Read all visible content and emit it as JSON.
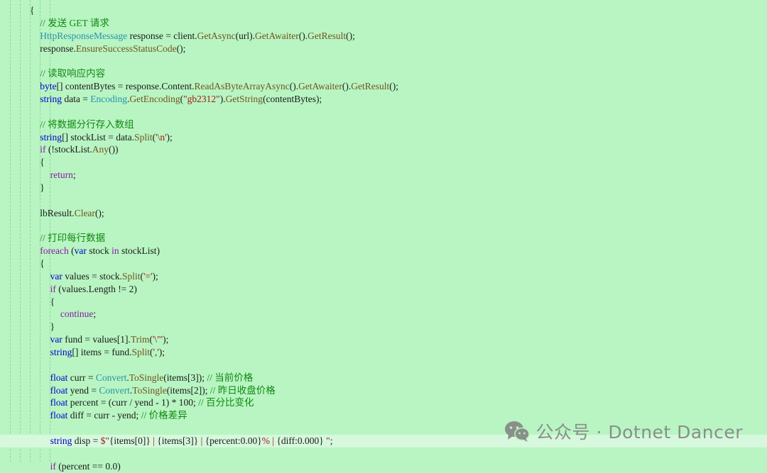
{
  "colors": {
    "background": "#b8f5c2",
    "highlight_line": "#d6f8dc",
    "keyword": "#0000cc",
    "control_keyword": "#8b1aa8",
    "type": "#2b91af",
    "method": "#74531f",
    "string": "#a31515",
    "comment": "#118811",
    "watermark": "#8a8f8b"
  },
  "watermark": {
    "icon": "wechat-icon",
    "text": "公众号 · Dotnet Dancer"
  },
  "lines": [
    {
      "indent": 0,
      "segments": [
        [
          "p",
          "{"
        ]
      ]
    },
    {
      "indent": 1,
      "segments": [
        [
          "c",
          "// 发送 GET 请求"
        ]
      ]
    },
    {
      "indent": 1,
      "segments": [
        [
          "t",
          "HttpResponseMessage"
        ],
        [
          "p",
          " response = client."
        ],
        [
          "m",
          "GetAsync"
        ],
        [
          "p",
          "(url)."
        ],
        [
          "m",
          "GetAwaiter"
        ],
        [
          "p",
          "()."
        ],
        [
          "m",
          "GetResult"
        ],
        [
          "p",
          "();"
        ]
      ]
    },
    {
      "indent": 1,
      "segments": [
        [
          "p",
          "response."
        ],
        [
          "m",
          "EnsureSuccessStatusCode"
        ],
        [
          "p",
          "();"
        ]
      ]
    },
    {
      "indent": 1,
      "segments": []
    },
    {
      "indent": 1,
      "segments": [
        [
          "c",
          "// 读取响应内容"
        ]
      ]
    },
    {
      "indent": 1,
      "segments": [
        [
          "k",
          "byte"
        ],
        [
          "p",
          "[] contentBytes = response.Content."
        ],
        [
          "m",
          "ReadAsByteArrayAsync"
        ],
        [
          "p",
          "()."
        ],
        [
          "m",
          "GetAwaiter"
        ],
        [
          "p",
          "()."
        ],
        [
          "m",
          "GetResult"
        ],
        [
          "p",
          "();"
        ]
      ]
    },
    {
      "indent": 1,
      "segments": [
        [
          "k",
          "string"
        ],
        [
          "p",
          " data = "
        ],
        [
          "t",
          "Encoding"
        ],
        [
          "p",
          "."
        ],
        [
          "m",
          "GetEncoding"
        ],
        [
          "p",
          "("
        ],
        [
          "s",
          "\"gb2312\""
        ],
        [
          "p",
          ")."
        ],
        [
          "m",
          "GetString"
        ],
        [
          "p",
          "(contentBytes);"
        ]
      ]
    },
    {
      "indent": 1,
      "segments": []
    },
    {
      "indent": 1,
      "segments": [
        [
          "c",
          "// 将数据分行存入数组"
        ]
      ]
    },
    {
      "indent": 1,
      "segments": [
        [
          "k",
          "string"
        ],
        [
          "p",
          "[] stockList = data."
        ],
        [
          "m",
          "Split"
        ],
        [
          "p",
          "("
        ],
        [
          "s",
          "'\\n'"
        ],
        [
          "p",
          ");"
        ]
      ]
    },
    {
      "indent": 1,
      "segments": [
        [
          "kp",
          "if"
        ],
        [
          "p",
          " (!stockList."
        ],
        [
          "m",
          "Any"
        ],
        [
          "p",
          "())"
        ]
      ]
    },
    {
      "indent": 1,
      "segments": [
        [
          "p",
          "{"
        ]
      ]
    },
    {
      "indent": 2,
      "segments": [
        [
          "kp",
          "return"
        ],
        [
          "p",
          ";"
        ]
      ]
    },
    {
      "indent": 1,
      "segments": [
        [
          "p",
          "}"
        ]
      ]
    },
    {
      "indent": 1,
      "segments": []
    },
    {
      "indent": 1,
      "segments": [
        [
          "p",
          "lbResult."
        ],
        [
          "m",
          "Clear"
        ],
        [
          "p",
          "();"
        ]
      ]
    },
    {
      "indent": 1,
      "segments": []
    },
    {
      "indent": 1,
      "segments": [
        [
          "c",
          "// 打印每行数据"
        ]
      ]
    },
    {
      "indent": 1,
      "segments": [
        [
          "kp",
          "foreach"
        ],
        [
          "p",
          " ("
        ],
        [
          "k",
          "var"
        ],
        [
          "p",
          " stock "
        ],
        [
          "kp",
          "in"
        ],
        [
          "p",
          " stockList)"
        ]
      ]
    },
    {
      "indent": 1,
      "segments": [
        [
          "p",
          "{"
        ]
      ]
    },
    {
      "indent": 2,
      "segments": [
        [
          "k",
          "var"
        ],
        [
          "p",
          " values = stock."
        ],
        [
          "m",
          "Split"
        ],
        [
          "p",
          "("
        ],
        [
          "s",
          "'='"
        ],
        [
          "p",
          ");"
        ]
      ]
    },
    {
      "indent": 2,
      "segments": [
        [
          "kp",
          "if"
        ],
        [
          "p",
          " (values.Length != 2)"
        ]
      ]
    },
    {
      "indent": 2,
      "segments": [
        [
          "p",
          "{"
        ]
      ]
    },
    {
      "indent": 3,
      "segments": [
        [
          "kp",
          "continue"
        ],
        [
          "p",
          ";"
        ]
      ]
    },
    {
      "indent": 2,
      "segments": [
        [
          "p",
          "}"
        ]
      ]
    },
    {
      "indent": 2,
      "segments": [
        [
          "k",
          "var"
        ],
        [
          "p",
          " fund = values[1]."
        ],
        [
          "m",
          "Trim"
        ],
        [
          "p",
          "("
        ],
        [
          "s",
          "'\\\"'"
        ],
        [
          "p",
          ");"
        ]
      ]
    },
    {
      "indent": 2,
      "segments": [
        [
          "k",
          "string"
        ],
        [
          "p",
          "[] items = fund."
        ],
        [
          "m",
          "Split"
        ],
        [
          "p",
          "("
        ],
        [
          "s",
          "','"
        ],
        [
          "p",
          ");"
        ]
      ]
    },
    {
      "indent": 2,
      "segments": []
    },
    {
      "indent": 2,
      "segments": [
        [
          "k",
          "float"
        ],
        [
          "p",
          " curr = "
        ],
        [
          "t",
          "Convert"
        ],
        [
          "p",
          "."
        ],
        [
          "m",
          "ToSingle"
        ],
        [
          "p",
          "(items[3]); "
        ],
        [
          "c",
          "// 当前价格"
        ]
      ]
    },
    {
      "indent": 2,
      "segments": [
        [
          "k",
          "float"
        ],
        [
          "p",
          " yend = "
        ],
        [
          "t",
          "Convert"
        ],
        [
          "p",
          "."
        ],
        [
          "m",
          "ToSingle"
        ],
        [
          "p",
          "(items[2]); "
        ],
        [
          "c",
          "// 昨日收盘价格"
        ]
      ]
    },
    {
      "indent": 2,
      "segments": [
        [
          "k",
          "float"
        ],
        [
          "p",
          " percent = (curr / yend - 1) * 100; "
        ],
        [
          "c",
          "// 百分比变化"
        ]
      ]
    },
    {
      "indent": 2,
      "segments": [
        [
          "k",
          "float"
        ],
        [
          "p",
          " diff = curr - yend; "
        ],
        [
          "c",
          "// 价格差异"
        ]
      ]
    },
    {
      "indent": 2,
      "segments": []
    },
    {
      "indent": 2,
      "highlight": true,
      "segments": [
        [
          "k",
          "string"
        ],
        [
          "p",
          " disp = "
        ],
        [
          "s",
          "$\""
        ],
        [
          "p",
          "{items[0]}"
        ],
        [
          "s",
          " | "
        ],
        [
          "p",
          "{items[3]}"
        ],
        [
          "s",
          " | "
        ],
        [
          "p",
          "{percent:0.00}"
        ],
        [
          "s",
          "% | "
        ],
        [
          "p",
          "{diff:0.000}"
        ],
        [
          "s",
          " \""
        ],
        [
          "p",
          ";"
        ]
      ]
    },
    {
      "indent": 2,
      "segments": []
    },
    {
      "indent": 2,
      "segments": [
        [
          "kp",
          "if"
        ],
        [
          "p",
          " (percent == 0.0)"
        ]
      ]
    }
  ]
}
